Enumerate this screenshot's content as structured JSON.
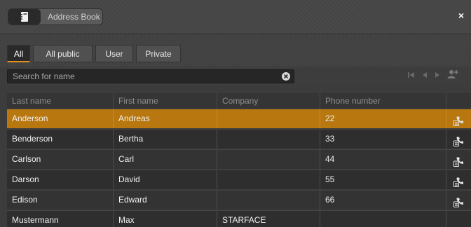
{
  "window": {
    "title": "Address Book",
    "close_label": "×"
  },
  "icons": {
    "title": "address-book-icon",
    "close": "close-icon",
    "clear": "clear-search-icon",
    "first": "first-page-icon",
    "prev": "previous-page-icon",
    "next": "next-page-icon",
    "add": "add-contact-icon",
    "row_action": "call-contact-icon"
  },
  "tabs": [
    {
      "label": "All",
      "active": true
    },
    {
      "label": "All public",
      "active": false
    },
    {
      "label": "User",
      "active": false
    },
    {
      "label": "Private",
      "active": false
    }
  ],
  "search": {
    "placeholder": "Search for name",
    "value": ""
  },
  "table": {
    "columns": [
      "Last name",
      "First name",
      "Company",
      "Phone number",
      ""
    ],
    "rows": [
      {
        "last": "Anderson",
        "first": "Andreas",
        "company": "",
        "phone": "22",
        "selected": true,
        "action": true
      },
      {
        "last": "Benderson",
        "first": "Bertha",
        "company": "",
        "phone": "33",
        "selected": false,
        "action": true
      },
      {
        "last": "Carlson",
        "first": "Carl",
        "company": "",
        "phone": "44",
        "selected": false,
        "action": true
      },
      {
        "last": "Darson",
        "first": "David",
        "company": "",
        "phone": "55",
        "selected": false,
        "action": true
      },
      {
        "last": "Edison",
        "first": "Edward",
        "company": "",
        "phone": "66",
        "selected": false,
        "action": true
      },
      {
        "last": "Mustermann",
        "first": "Max",
        "company": "STARFACE",
        "phone": "",
        "selected": false,
        "action": false
      }
    ]
  },
  "colors": {
    "accent": "#e4901a",
    "selected_row": "#b8770f"
  }
}
